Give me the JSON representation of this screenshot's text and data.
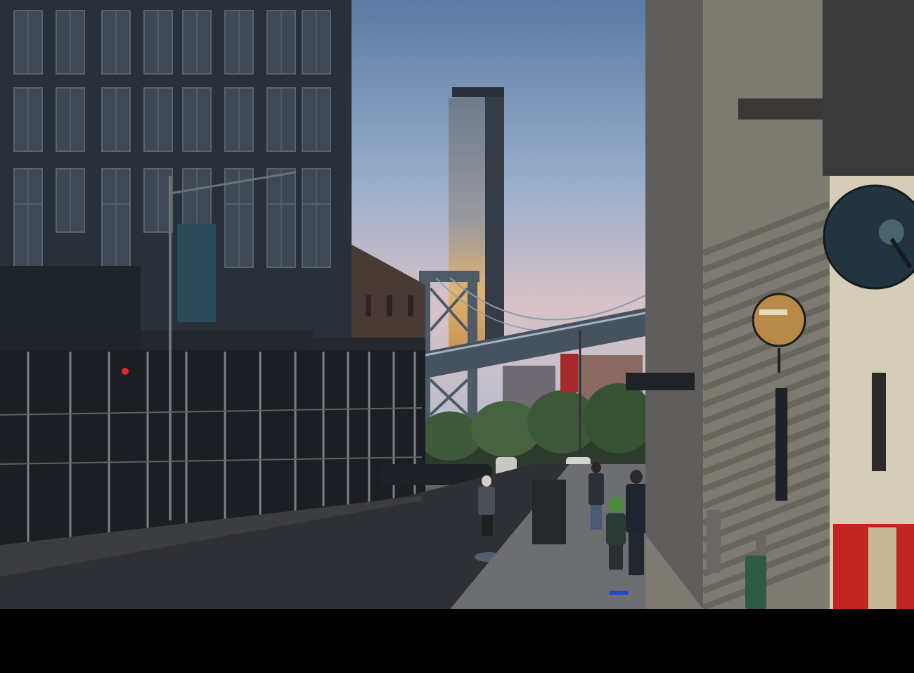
{
  "photo": {
    "kind": "street-scene"
  }
}
